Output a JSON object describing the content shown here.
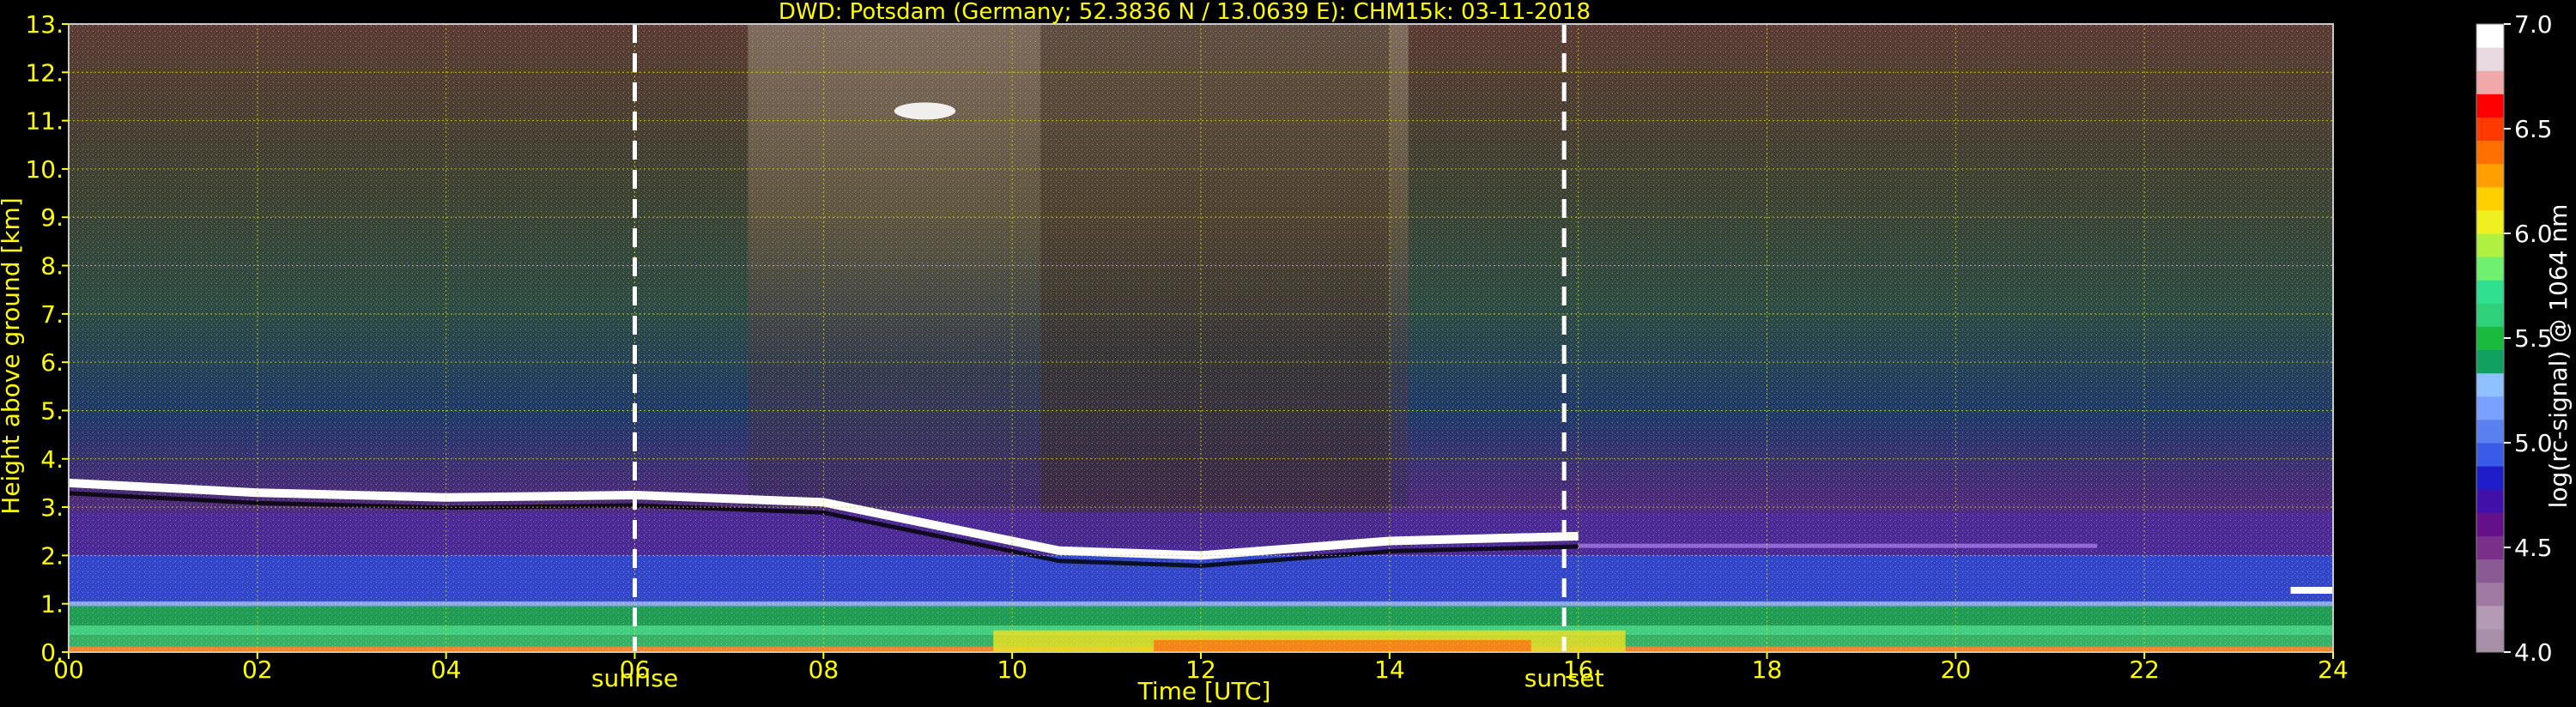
{
  "chart_data": {
    "type": "heatmap",
    "title": "DWD: Potsdam (Germany; 52.3836 N / 13.0639 E):    CHM15k: 03-11-2018",
    "xlabel": "Time [UTC]",
    "ylabel": "Height above ground [km]",
    "xlim": [
      0,
      24
    ],
    "ylim": [
      0,
      13
    ],
    "x_ticks": [
      "00",
      "02",
      "04",
      "06",
      "08",
      "10",
      "12",
      "14",
      "16",
      "18",
      "20",
      "22",
      "24"
    ],
    "x_tick_values": [
      0,
      2,
      4,
      6,
      8,
      10,
      12,
      14,
      16,
      18,
      20,
      22,
      24
    ],
    "y_ticks": [
      "0.",
      "1.",
      "2.",
      "3.",
      "4.",
      "5.",
      "6.",
      "7.",
      "8.",
      "9.",
      "10.",
      "11.",
      "12.",
      "13."
    ],
    "y_tick_values": [
      0,
      1,
      2,
      3,
      4,
      5,
      6,
      7,
      8,
      9,
      10,
      11,
      12,
      13
    ],
    "grid": true,
    "events": [
      {
        "label": "sunrise",
        "time": 6.0
      },
      {
        "label": "sunset",
        "time": 15.85
      }
    ],
    "colorbar": {
      "label": "log(rc-signal) @ 1064 nm",
      "range": [
        4.0,
        7.0
      ],
      "ticks": [
        "4.0",
        "4.5",
        "5.0",
        "5.5",
        "6.0",
        "6.5",
        "7.0"
      ],
      "tick_values": [
        4.0,
        4.5,
        5.0,
        5.5,
        6.0,
        6.5,
        7.0
      ],
      "colors": [
        "#a890a8",
        "#b59ab5",
        "#a07aa0",
        "#8a5a94",
        "#7a2f88",
        "#64108a",
        "#4010a8",
        "#1e1ec8",
        "#3a5ae8",
        "#5a80f0",
        "#7aa0ff",
        "#8fc0ff",
        "#10a060",
        "#1aba3e",
        "#2ed07a",
        "#30e090",
        "#70f070",
        "#b0f040",
        "#f0f020",
        "#ffd000",
        "#ffa000",
        "#ff7000",
        "#ff3a00",
        "#ff0000",
        "#f0a8a8",
        "#e8d8e0",
        "#ffffff"
      ]
    },
    "features": {
      "residual_layer_top_km": [
        {
          "t": 0.0,
          "h": 3.5
        },
        {
          "t": 2.0,
          "h": 3.3
        },
        {
          "t": 4.0,
          "h": 3.2
        },
        {
          "t": 6.0,
          "h": 3.25
        },
        {
          "t": 8.0,
          "h": 3.1
        },
        {
          "t": 10.5,
          "h": 2.1
        },
        {
          "t": 12.0,
          "h": 2.0
        },
        {
          "t": 14.0,
          "h": 2.3
        },
        {
          "t": 16.0,
          "h": 2.4
        }
      ],
      "cirrus_patch": {
        "t_start": 8.75,
        "t_end": 9.4,
        "h": 11.2
      },
      "surface_signal_peak": {
        "t_start": 11.5,
        "t_end": 15.5,
        "value": 6.0
      }
    }
  }
}
